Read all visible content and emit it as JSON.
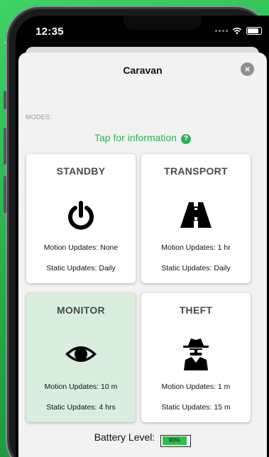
{
  "status_bar": {
    "time": "12:35",
    "icons": [
      "signal-icon",
      "wifi-icon",
      "battery-icon"
    ]
  },
  "sheet": {
    "title": "Caravan",
    "close_icon": "close-icon",
    "modes_label": "MODES:",
    "info_text": "Tap for information",
    "info_icon_glyph": "?"
  },
  "modes": [
    {
      "title": "STANDBY",
      "icon": "power-icon",
      "motion": "Motion Updates: None",
      "static": "Static Updates: Daily",
      "selected": false
    },
    {
      "title": "TRANSPORT",
      "icon": "road-icon",
      "motion": "Motion Updates: 1 hr",
      "static": "Static Updates: Daily",
      "selected": false
    },
    {
      "title": "MONITOR",
      "icon": "eye-icon",
      "motion": "Motion Updates: 10 m",
      "static": "Static Updates: 4 hrs",
      "selected": true
    },
    {
      "title": "THEFT",
      "icon": "spy-icon",
      "motion": "Motion Updates: 1 m",
      "static": "Static Updates: 15 m",
      "selected": false
    }
  ],
  "battery": {
    "label": "Battery Level:",
    "value_text": "90%",
    "level": 0.9
  },
  "colors": {
    "accent": "#2fb15a",
    "selected_card": "#d9eedd",
    "battery_fill": "#2dbe4a",
    "background": "#2fbf52"
  }
}
